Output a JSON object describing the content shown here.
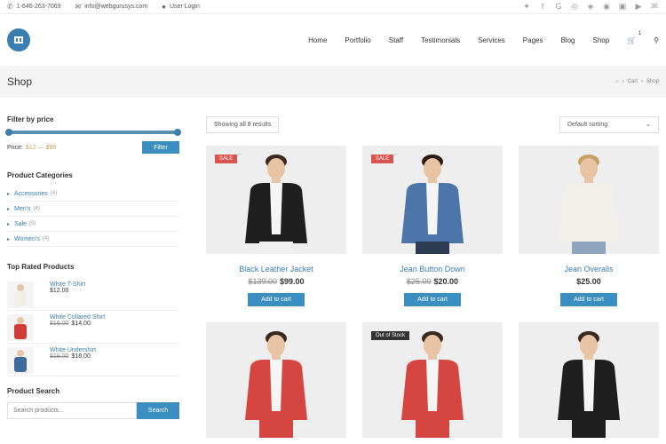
{
  "topbar": {
    "phone": "1-646-263-7069",
    "email": "info@webgurusys.com",
    "login": "User Login"
  },
  "nav": {
    "items": [
      "Home",
      "Portfolio",
      "Staff",
      "Testimonials",
      "Services",
      "Pages",
      "Blog",
      "Shop"
    ],
    "cart_count": "1"
  },
  "page": {
    "title": "Shop",
    "crumbs": [
      "Cart",
      "Shop"
    ]
  },
  "sidebar": {
    "filter": {
      "title": "Filter by price",
      "price_label": "Price:",
      "price_value": "$12 — $99",
      "button": "Filter"
    },
    "categories": {
      "title": "Product Categories",
      "items": [
        {
          "label": "Accessories",
          "count": "(4)"
        },
        {
          "label": "Men's",
          "count": "(4)"
        },
        {
          "label": "Sale",
          "count": "(5)"
        },
        {
          "label": "Women's",
          "count": "(4)"
        }
      ]
    },
    "top_rated": {
      "title": "Top Rated Products",
      "items": [
        {
          "name": "White T-Shirt",
          "old": "",
          "price": "$12.00",
          "color": "#f2efe9"
        },
        {
          "name": "White Collared Shirt",
          "old": "$16.00",
          "price": "$14.00",
          "color": "#cf3b36"
        },
        {
          "name": "White Undershirt",
          "old": "$19.00",
          "price": "$18.00",
          "color": "#3f6a9c"
        }
      ]
    },
    "search": {
      "title": "Product Search",
      "placeholder": "Search products...",
      "button": "Search"
    }
  },
  "main": {
    "result_count": "Showing all 8 results",
    "sorting": "Default sorting",
    "add_label": "Add to cart",
    "products": [
      {
        "name": "Black Leather Jacket",
        "old": "$139.00",
        "price": "$99.00",
        "badge": "SALE",
        "badge_type": "sale",
        "colors": {
          "body": "#1f1f1f",
          "shirt": "#f5f5f5",
          "legs": "#f0f0f0",
          "hair": "#3a2a20"
        }
      },
      {
        "name": "Jean Button Down",
        "old": "$25.00",
        "price": "$20.00",
        "badge": "SALE",
        "badge_type": "sale",
        "colors": {
          "body": "#4b74a8",
          "shirt": "#f5f5f5",
          "legs": "#2d3c52",
          "hair": "#2a1c12"
        }
      },
      {
        "name": "Jean Overalls",
        "old": "",
        "price": "$25.00",
        "badge": "",
        "badge_type": "",
        "colors": {
          "body": "#f1efea",
          "shirt": "#f1efea",
          "legs": "#8fa5be",
          "hair": "#c9a064"
        }
      },
      {
        "name": "",
        "old": "",
        "price": "",
        "badge": "",
        "badge_type": "",
        "colors": {
          "body": "#d4463f",
          "shirt": "#f5f5f5",
          "legs": "#d4463f",
          "hair": "#3a2a20"
        }
      },
      {
        "name": "",
        "old": "",
        "price": "",
        "badge": "Out of Stock",
        "badge_type": "oos",
        "colors": {
          "body": "#d4463f",
          "shirt": "#f5f5f5",
          "legs": "#d4463f",
          "hair": "#3a2a20"
        }
      },
      {
        "name": "",
        "old": "",
        "price": "",
        "badge": "",
        "badge_type": "",
        "colors": {
          "body": "#1f1f1f",
          "shirt": "#f5f5f5",
          "legs": "#1f1f1f",
          "hair": "#3a2a20"
        }
      }
    ]
  }
}
